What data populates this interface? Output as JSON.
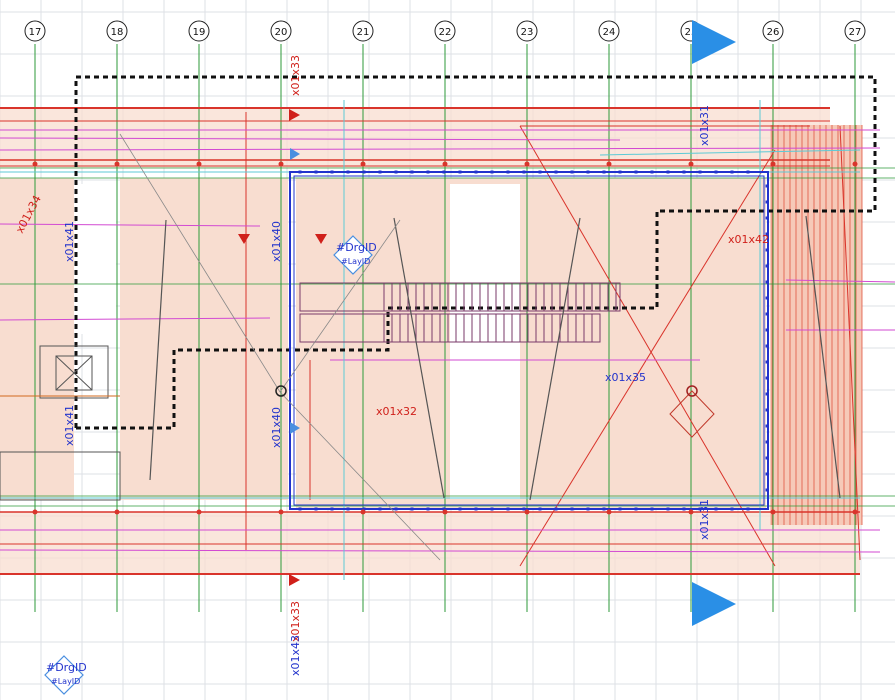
{
  "colors": {
    "background": "#ffffff",
    "grid_fine": "#d9dde3",
    "grid_axis": "#2e9a3a",
    "slab_fill": "#f8ddd0",
    "beam_red": "#d9342b",
    "wall_blue": "#2233cc",
    "magenta": "#d24ad2",
    "cyan": "#5ccad6",
    "label_red": "#d0201a",
    "label_blue": "#2233cc",
    "marker_blue": "#2a8fe6"
  },
  "grid_axes": [
    {
      "label": "17"
    },
    {
      "label": "18"
    },
    {
      "label": "19"
    },
    {
      "label": "20"
    },
    {
      "label": "21"
    },
    {
      "label": "22"
    },
    {
      "label": "23"
    },
    {
      "label": "24"
    },
    {
      "label": "25"
    },
    {
      "label": "26"
    },
    {
      "label": "27"
    }
  ],
  "tags": {
    "red": [
      "x01x33",
      "x01x34",
      "x01x42",
      "x01x32",
      "x01x33"
    ],
    "blue": [
      "x01x31",
      "x01x41",
      "x01x40",
      "x01x40",
      "x01x41",
      "x01x35",
      "x01x31",
      "x01x43"
    ]
  },
  "drawing_id": {
    "upper": {
      "drg": "#DrgID",
      "lay": "#LayID"
    },
    "lower": {
      "drg": "#DrgID",
      "lay": "#LayID"
    }
  },
  "icons": [
    "section-marker-icon",
    "column-cross-icon",
    "elevation-triangle-icon"
  ]
}
